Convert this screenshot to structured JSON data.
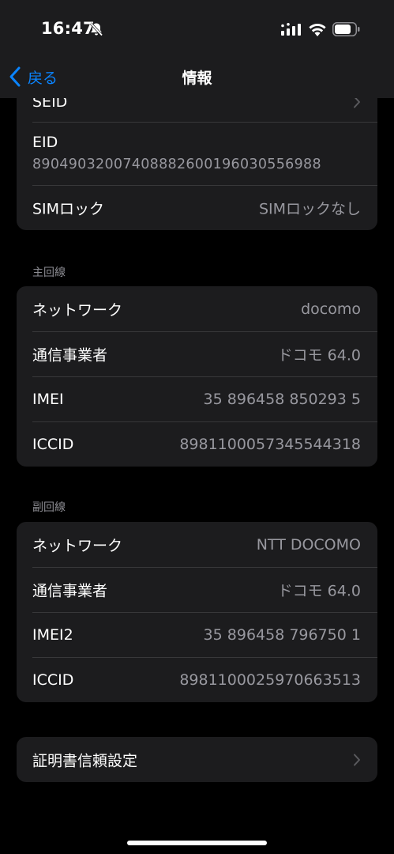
{
  "status": {
    "time": "16:47"
  },
  "nav": {
    "back_label": "戻る",
    "title": "情報"
  },
  "sim_card": {
    "seid_label": "SEID",
    "eid_label": "EID",
    "eid_value": "89049032007408882600196030556988",
    "simlock_label": "SIMロック",
    "simlock_value": "SIMロックなし"
  },
  "primary": {
    "header": "主回線",
    "rows": [
      {
        "label": "ネットワーク",
        "value": "docomo"
      },
      {
        "label": "通信事業者",
        "value": "ドコモ 64.0"
      },
      {
        "label": "IMEI",
        "value": "35 896458 850293 5"
      },
      {
        "label": "ICCID",
        "value": "8981100057345544318"
      }
    ]
  },
  "secondary": {
    "header": "副回線",
    "rows": [
      {
        "label": "ネットワーク",
        "value": "NTT DOCOMO"
      },
      {
        "label": "通信事業者",
        "value": "ドコモ 64.0"
      },
      {
        "label": "IMEI2",
        "value": "35 896458 796750 1"
      },
      {
        "label": "ICCID",
        "value": "8981100025970663513"
      }
    ]
  },
  "cert": {
    "label": "証明書信頼設定"
  },
  "icons": {
    "back": "chevron-left-icon",
    "bell": "bell-slash-icon",
    "signal": "cellular-signal-icon",
    "wifi": "wifi-icon",
    "battery": "battery-icon",
    "chevron": "chevron-right-icon"
  },
  "colors": {
    "accent": "#0a84ff",
    "card": "#1c1c1e",
    "secondary_text": "#98989f"
  }
}
